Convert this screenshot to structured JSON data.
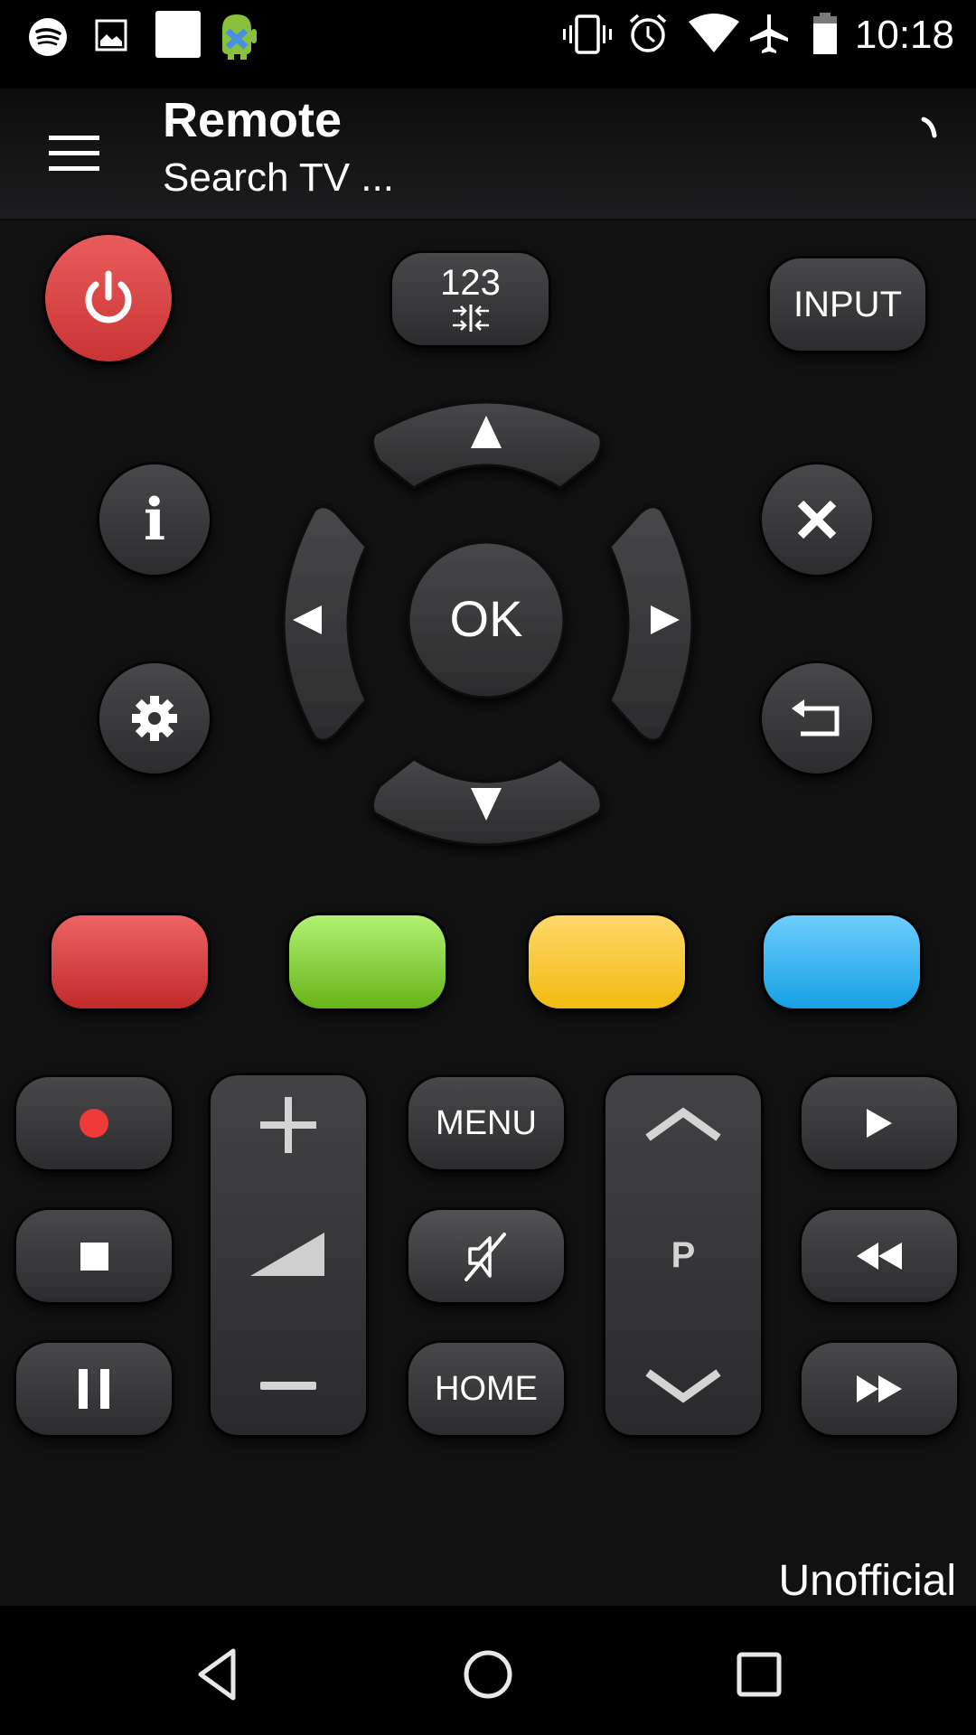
{
  "status_bar": {
    "time": "10:18",
    "left_icons": [
      "spotify-icon",
      "image-icon",
      "blank-notification-icon",
      "android-app-icon"
    ],
    "right_icons": [
      "vibrate-icon",
      "alarm-icon",
      "wifi-icon",
      "airplane-mode-icon",
      "battery-icon"
    ]
  },
  "app_bar": {
    "title": "Remote",
    "subtitle": "Search TV ...",
    "menu_icon": "hamburger-menu-icon",
    "loading_icon": "spinner-icon"
  },
  "top_row": {
    "power_icon": "power-icon",
    "numpad_label": "123",
    "numpad_icon": "collapse-arrows-icon",
    "input_label": "INPUT"
  },
  "dpad": {
    "ok_label": "OK",
    "up_icon": "triangle-up-icon",
    "down_icon": "triangle-down-icon",
    "left_icon": "triangle-left-icon",
    "right_icon": "triangle-right-icon"
  },
  "side_buttons": {
    "info_label": "i",
    "settings_icon": "gear-icon",
    "close_icon": "close-icon",
    "back_icon": "return-arrow-icon"
  },
  "color_buttons": [
    {
      "name": "red",
      "top": "#ee6464",
      "bottom": "#c22a2a"
    },
    {
      "name": "green",
      "top": "#b2f175",
      "bottom": "#67b417"
    },
    {
      "name": "yellow",
      "top": "#ffd76a",
      "bottom": "#f0bc10"
    },
    {
      "name": "blue",
      "top": "#6fcdfc",
      "bottom": "#16a0e4"
    }
  ],
  "controls": {
    "record_icon": "record-icon",
    "stop_icon": "stop-icon",
    "pause_icon": "pause-icon",
    "volume_up_icon": "plus-icon",
    "volume_icon": "volume-level-icon",
    "volume_down_icon": "minus-icon",
    "menu_label": "MENU",
    "mute_icon": "mute-icon",
    "home_label": "HOME",
    "channel_up_icon": "chevron-up-icon",
    "channel_label": "P",
    "channel_down_icon": "chevron-down-icon",
    "play_icon": "play-icon",
    "rewind_icon": "rewind-icon",
    "fast_forward_icon": "fast-forward-icon"
  },
  "footer": {
    "unofficial_label": "Unofficial"
  },
  "nav_bar": {
    "back_icon": "nav-back-icon",
    "home_icon": "nav-home-icon",
    "recents_icon": "nav-recents-icon"
  },
  "colors": {
    "background": "#111112",
    "power_button": "#e04848",
    "record_dot": "#f03a3a",
    "button_face": "#3a3a3d"
  }
}
